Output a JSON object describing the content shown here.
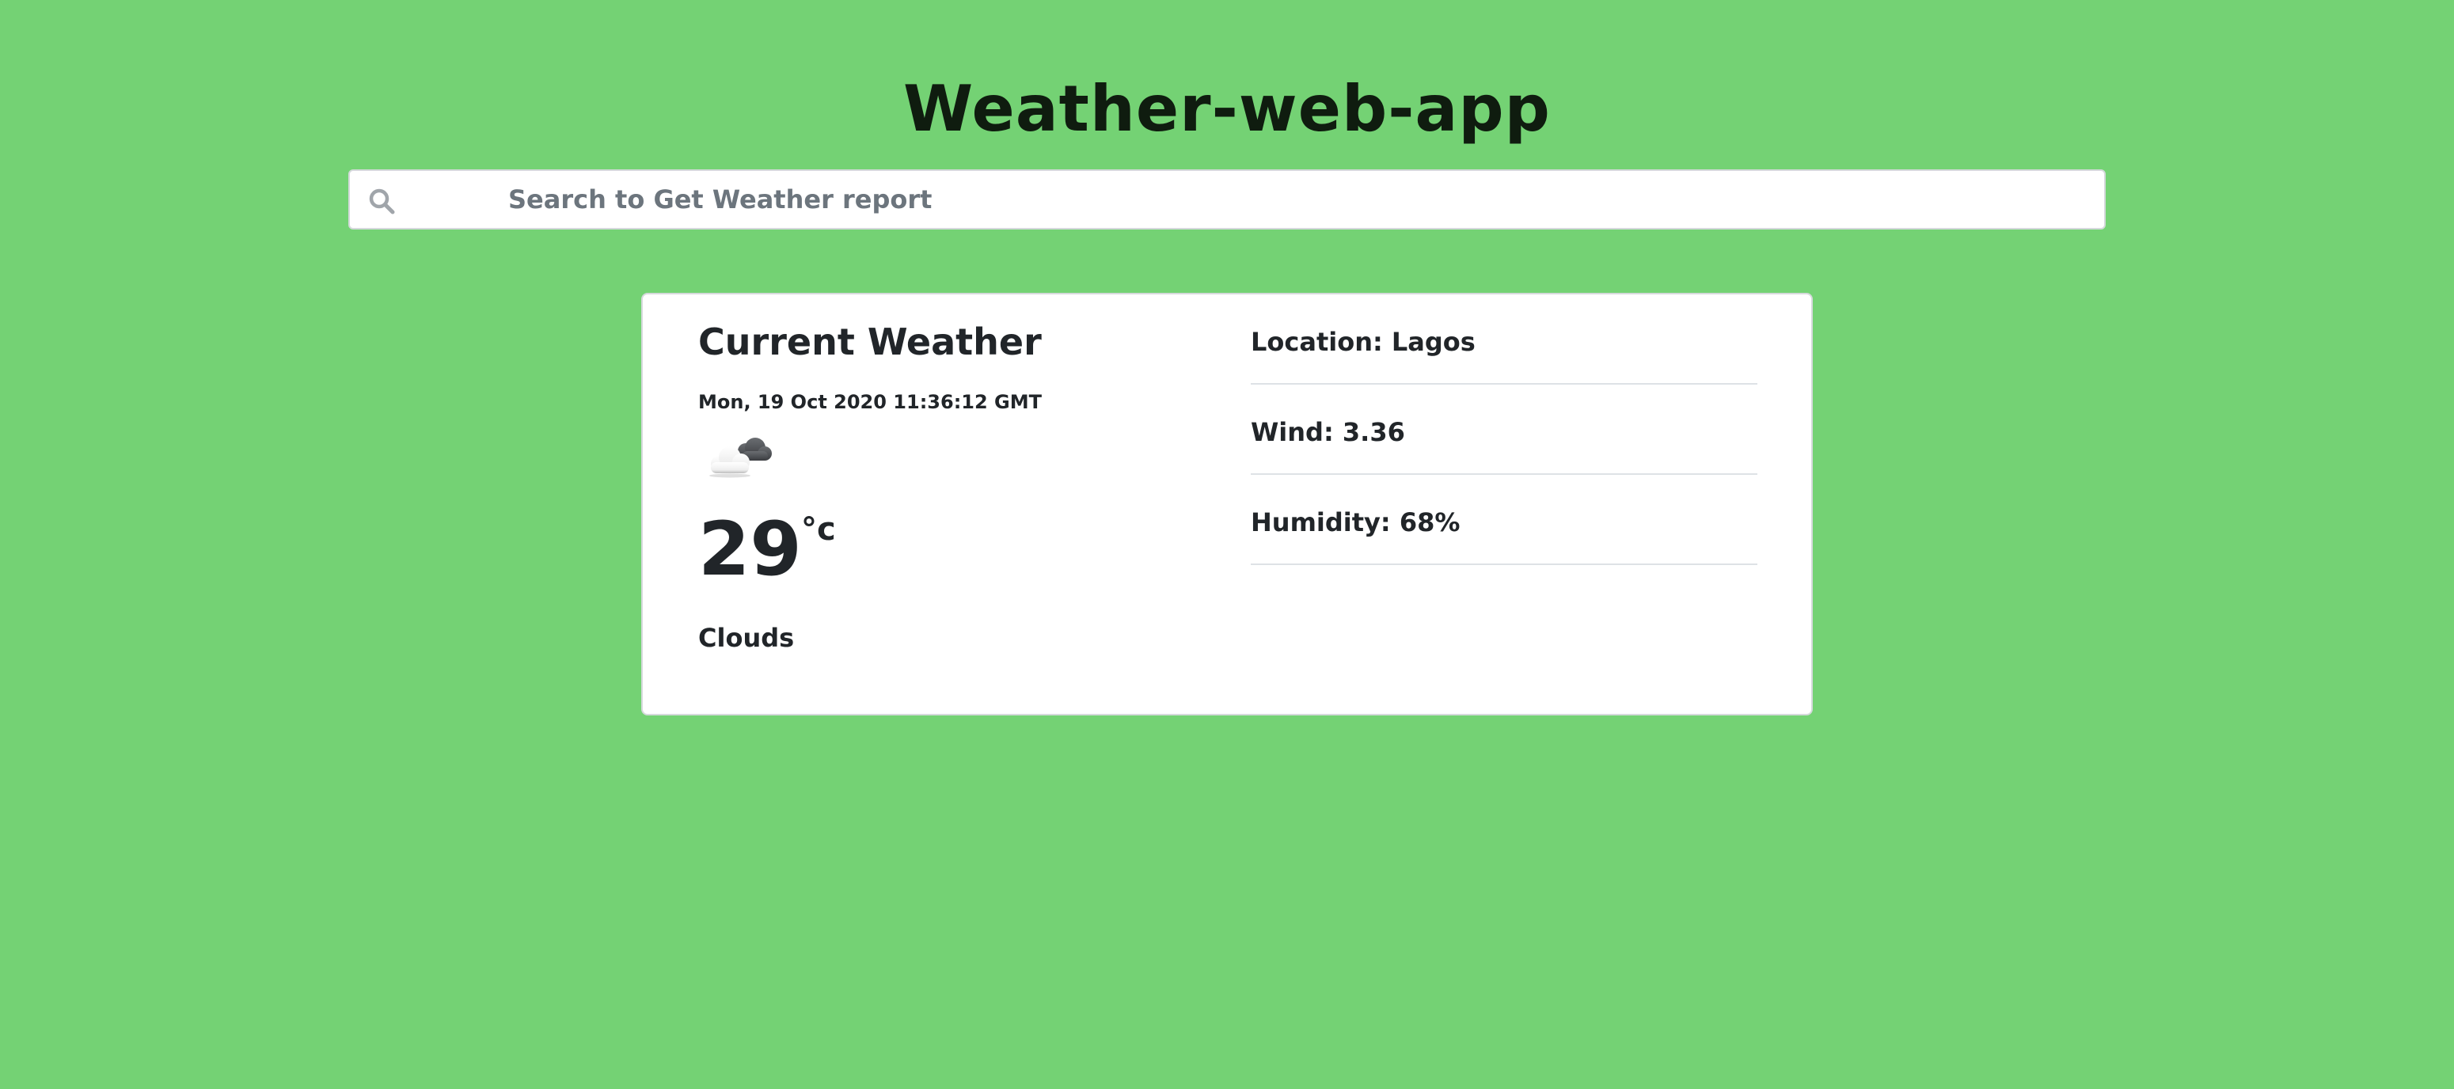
{
  "header": {
    "title": "Weather-web-app"
  },
  "search": {
    "placeholder": "Search to Get Weather report",
    "value": "",
    "icon": "search-icon"
  },
  "weather": {
    "heading": "Current Weather",
    "datetime": "Mon, 19 Oct 2020 11:36:12 GMT",
    "icon": "cloudy-icon",
    "temperature": "29",
    "unit": "°c",
    "condition": "Clouds",
    "details": [
      {
        "text": "Location: Lagos"
      },
      {
        "text": "Wind: 3.36"
      },
      {
        "text": "Humidity: 68%"
      }
    ]
  },
  "colors": {
    "background": "#74d274",
    "card": "#ffffff",
    "text": "#212529",
    "title": "#0f1c0f",
    "placeholder": "#6c757d",
    "divider": "#dee2e6"
  }
}
